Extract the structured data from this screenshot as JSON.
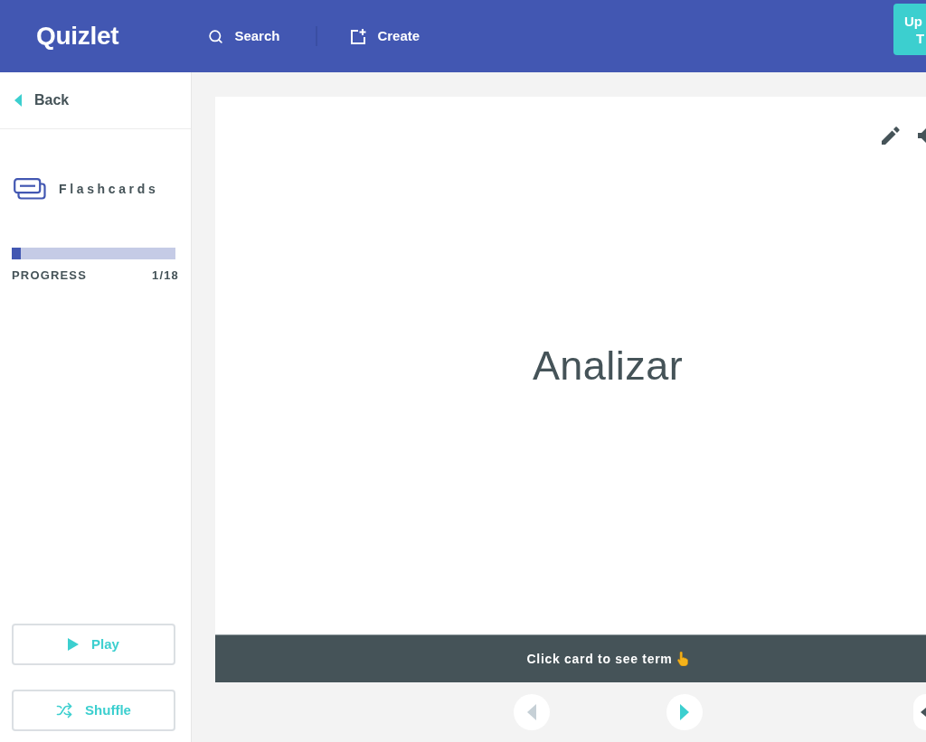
{
  "header": {
    "logo": "Quizlet",
    "nav": [
      {
        "kind": "search",
        "label": "Search"
      },
      {
        "kind": "create",
        "label": "Create"
      }
    ],
    "upgrade_button": {
      "lines": [
        "Up",
        "T"
      ]
    }
  },
  "sidebar": {
    "back": "Back",
    "mode": "Flashcards",
    "progress": {
      "label": "PROGRESS",
      "count": "1/18",
      "level": 0.056
    },
    "buttons": [
      {
        "kind": "play",
        "label": "Play"
      },
      {
        "kind": "shuffle",
        "label": "Shuffle"
      }
    ]
  },
  "card": {
    "term": "Analizar",
    "hint": "Click card to see term"
  },
  "navigation": [
    {
      "kind": "previous",
      "disabled": true
    },
    {
      "kind": "next",
      "disabled": false
    },
    {
      "kind": "edge",
      "disabled": false
    }
  ]
}
